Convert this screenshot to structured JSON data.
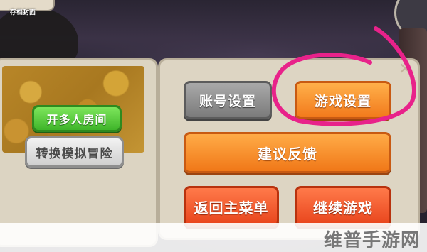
{
  "save_panel": {
    "title": "存档封面",
    "camera": "camera-icon",
    "multiplayer_label": "开多人房间",
    "switch_label": "转换模拟冒险"
  },
  "menu": {
    "account_settings": "账号设置",
    "game_settings": "游戏设置",
    "feedback": "建议反馈",
    "main_menu": "返回主菜单",
    "continue": "继续游戏"
  },
  "watermark": "维普手游网",
  "colors": {
    "orange": "#f27a1c",
    "red_orange": "#e8441c",
    "green": "#3fb52a",
    "annotation": "#e8228a"
  }
}
